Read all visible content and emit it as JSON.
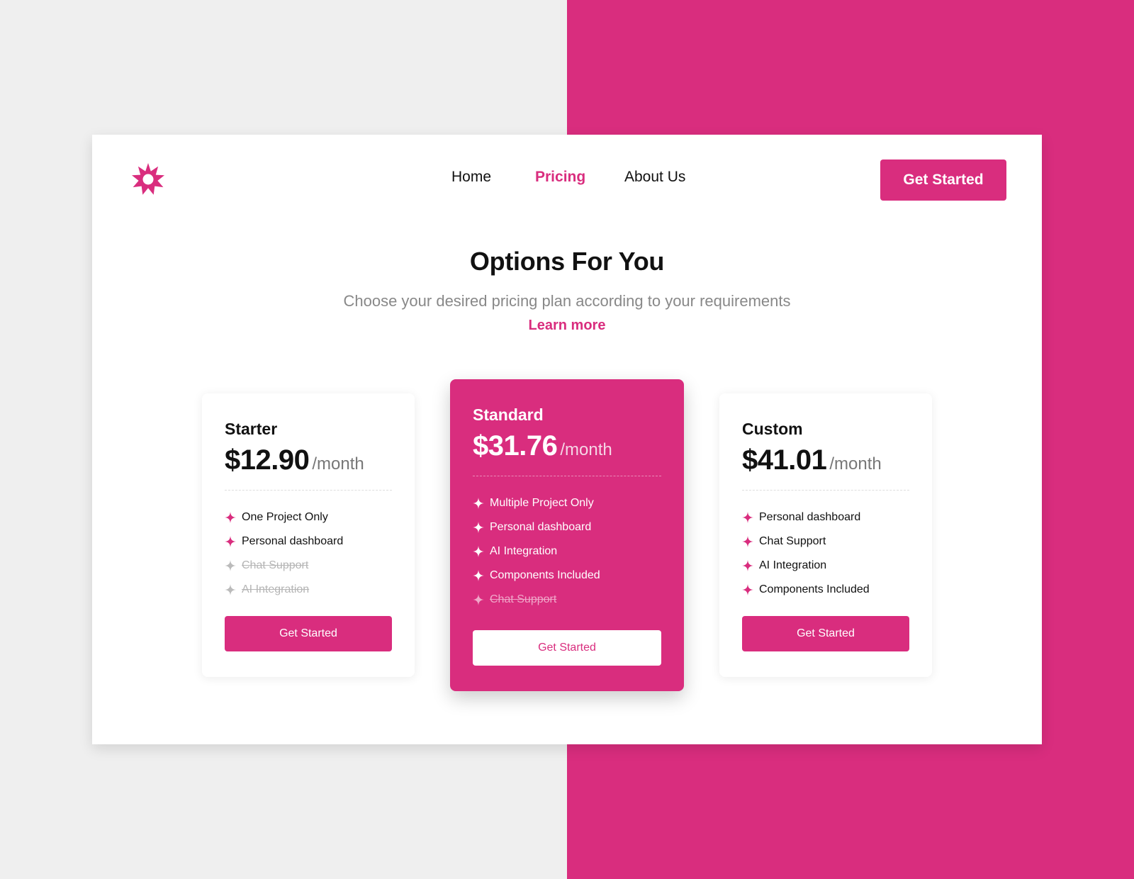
{
  "colors": {
    "brand": "#d92d7e",
    "background_left": "#efefef",
    "background_right": "#d92d7e",
    "text_primary": "#111111",
    "text_muted": "#888888"
  },
  "header": {
    "logo_icon": "starburst-logo-icon",
    "nav": [
      {
        "label": "Home",
        "active": false
      },
      {
        "label": "Pricing",
        "active": true
      },
      {
        "label": "About Us",
        "active": false
      }
    ],
    "cta_label": "Get Started"
  },
  "hero": {
    "title": "Options For You",
    "subtitle": "Choose your desired pricing plan according to your requirements",
    "link_label": "Learn more"
  },
  "plans": [
    {
      "name": "Starter",
      "price": "$12.90",
      "period": "/month",
      "highlighted": false,
      "features": [
        {
          "label": "One Project Only",
          "included": true
        },
        {
          "label": "Personal dashboard",
          "included": true
        },
        {
          "label": "Chat Support",
          "included": false
        },
        {
          "label": "AI Integration",
          "included": false
        }
      ],
      "button_label": "Get Started"
    },
    {
      "name": "Standard",
      "price": "$31.76",
      "period": "/month",
      "highlighted": true,
      "features": [
        {
          "label": "Multiple Project Only",
          "included": true
        },
        {
          "label": "Personal dashboard",
          "included": true
        },
        {
          "label": "AI Integration",
          "included": true
        },
        {
          "label": "Components Included",
          "included": true
        },
        {
          "label": "Chat Support",
          "included": false
        }
      ],
      "button_label": "Get Started"
    },
    {
      "name": "Custom",
      "price": "$41.01",
      "period": "/month",
      "highlighted": false,
      "features": [
        {
          "label": "Personal dashboard",
          "included": true
        },
        {
          "label": "Chat Support",
          "included": true
        },
        {
          "label": "AI Integration",
          "included": true
        },
        {
          "label": "Components Included",
          "included": true
        }
      ],
      "button_label": "Get Started"
    }
  ],
  "feature_icon": "sparkle-icon"
}
